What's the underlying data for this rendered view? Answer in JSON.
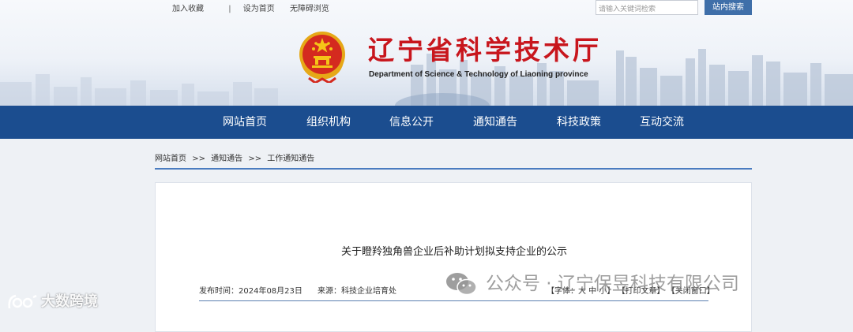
{
  "header": {
    "links": [
      "加入收藏",
      "设为首页",
      "无障碍浏览"
    ],
    "link_separator": "|",
    "search_placeholder": "请输入关键词检索",
    "search_button": "站内搜索",
    "title": "辽宁省科学技术厅",
    "subtitle": "Department of Science & Technology of Liaoning province"
  },
  "nav": {
    "items": [
      "网站首页",
      "组织机构",
      "信息公开",
      "通知通告",
      "科技政策",
      "互动交流"
    ]
  },
  "breadcrumb": {
    "items": [
      "网站首页",
      "通知通告",
      "工作通知通告"
    ],
    "separator": ">>"
  },
  "article": {
    "title": "关于瞪羚独角兽企业后补助计划拟支持企业的公示",
    "publish_time": "发布时间：2024年08月23日",
    "source": "来源：科技企业培育处",
    "font_size_label": "【字体：大 中 小】",
    "print_label": "【打印文章】",
    "close_label": "【关闭窗口】"
  },
  "watermarks": {
    "wechat": "公众号 · 辽宁保昱科技有限公司",
    "left": "大数跨境"
  },
  "colors": {
    "nav_bg": "#1b4d8f",
    "title_red": "#c8161d",
    "search_button_bg": "#3f6fa9",
    "accent_line": "#4a7cc0"
  }
}
